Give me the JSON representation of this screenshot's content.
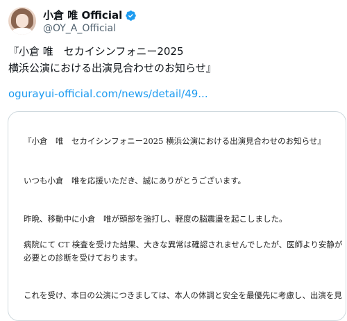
{
  "author": {
    "name": "小倉 唯 Official",
    "handle": "@OY_A_Official"
  },
  "tweet": {
    "lines": [
      "『小倉 唯　セカイシンフォニー2025",
      "横浜公演における出演見合わせのお知らせ』"
    ],
    "link_text": "ogurayui-official.com/news/detail/49..."
  },
  "document": {
    "lines": [
      "『小倉　唯　セカイシンフォニー2025 横浜公演における出演見合わせのお知らせ』",
      "いつも小倉　唯を応援いただき、誠にありがとうございます。",
      "昨晩、移動中に小倉　唯が頭部を強打し、軽度の脳震盪を起こしました。",
      "病院にて CT 検査を受けた結果、大きな異常は確認されませんでしたが、医師より安静が",
      "必要との診断を受けております。",
      "これを受け、本日の公演につきましては、本人の体調と安全を最優先に考慮し、出演を見"
    ]
  },
  "colors": {
    "verified": "#1d9bf0",
    "link": "#1d9bf0",
    "secondary_text": "#536471",
    "card_border": "#cfd9de"
  }
}
